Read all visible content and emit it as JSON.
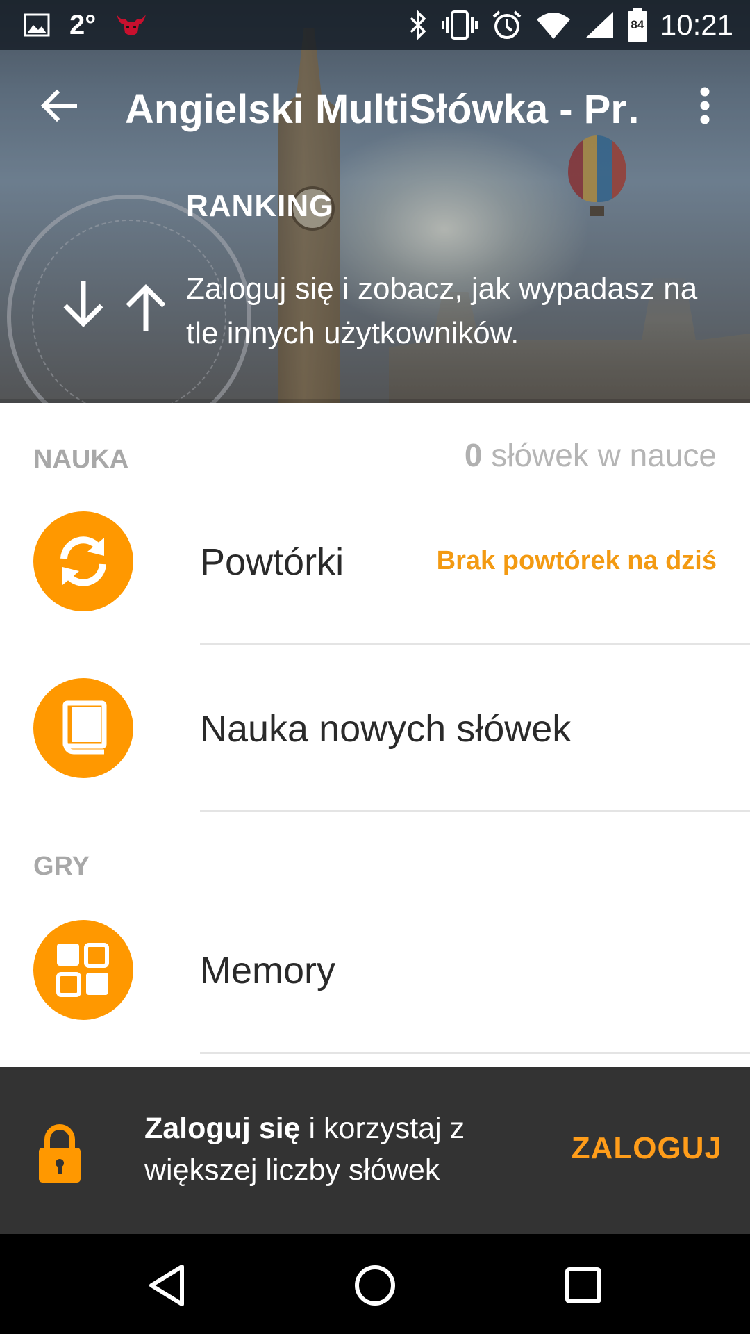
{
  "status_bar": {
    "temperature": "2°",
    "time": "10:21",
    "battery_level": "84",
    "icons": [
      "image-icon",
      "bulls-logo-icon",
      "bluetooth-icon",
      "vibrate-icon",
      "alarm-icon",
      "wifi-icon",
      "signal-icon",
      "battery-icon"
    ]
  },
  "toolbar": {
    "title": "Angielski MultiSłówka - Pr…",
    "back_icon": "arrow-back-icon",
    "more_icon": "more-vertical-icon"
  },
  "ranking": {
    "title": "RANKING",
    "text": "Zaloguj się i zobacz, jak wypadasz na tle innych użytkowników.",
    "icon": "sort-arrows-icon"
  },
  "nauka": {
    "section_label": "NAUKA",
    "count_number": "0",
    "count_suffix": " słówek w nauce",
    "items": [
      {
        "label": "Powtórki",
        "note": "Brak powtórek na dziś",
        "icon": "sync-icon"
      },
      {
        "label": "Nauka nowych słówek",
        "icon": "book-icon"
      }
    ]
  },
  "gry": {
    "section_label": "GRY",
    "items": [
      {
        "label": "Memory",
        "icon": "grid-icon"
      }
    ]
  },
  "snackbar": {
    "message_bold": "Zaloguj się",
    "message_rest": " i korzystaj z większej liczby słówek",
    "action": "ZALOGUJ",
    "icon": "lock-icon"
  },
  "navigation": {
    "icons": [
      "back-triangle-icon",
      "home-circle-icon",
      "recents-square-icon"
    ]
  },
  "colors": {
    "accent": "#ff9800",
    "action_text": "#ff9d1a",
    "snackbar_bg": "#333333",
    "section_label": "#a8a8a8"
  }
}
